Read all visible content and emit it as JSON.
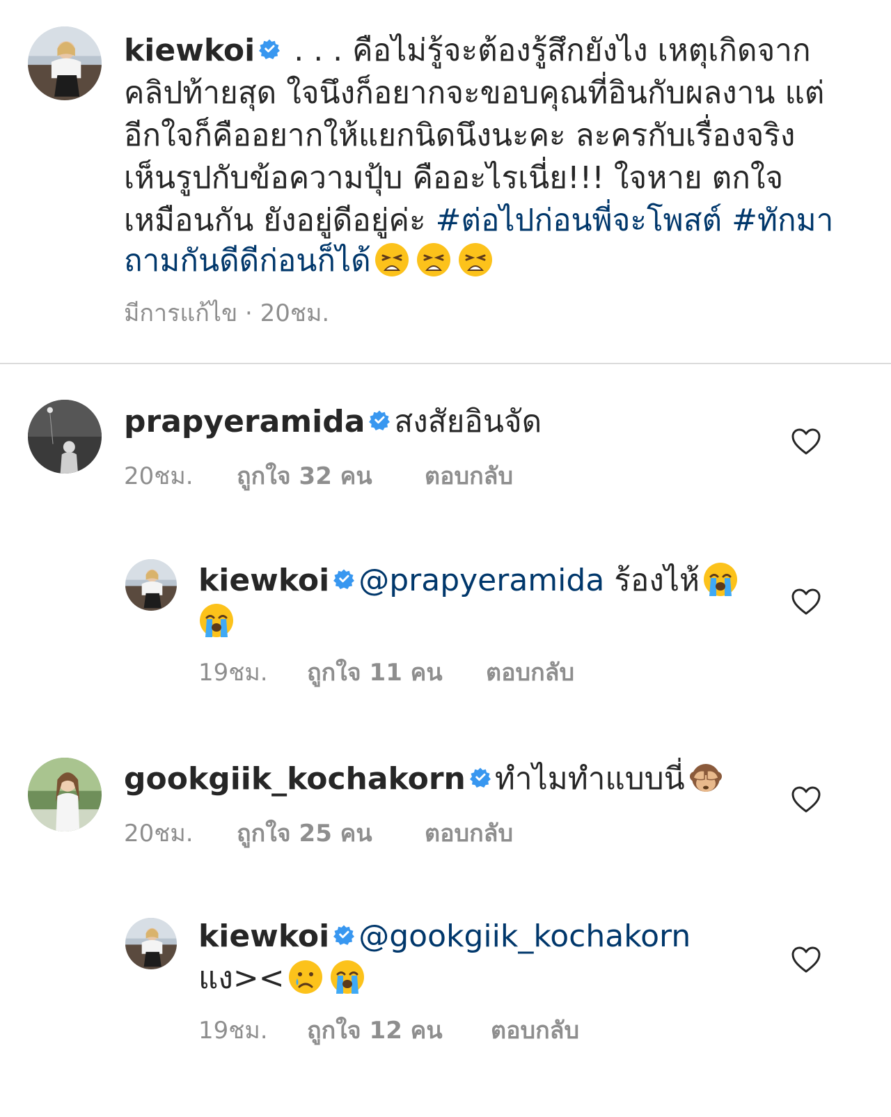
{
  "caption": {
    "username": "kiewkoi",
    "lines": [
      " . . . คือไม่รู้จะต้องรู้สึกยังไง เหตุเกิดจาก",
      "คลิปท้ายสุด ใจนึงก็อยากจะขอบคุณที่อินกับผลงาน แต่",
      "อีกใจก็คืออยากให้แยกนิดนึงนะคะ ละครกับเรื่องจริง",
      "เห็นรูปกับข้อความปุ้บ คืออะไรเนี่ย!!! ใจหาย ตกใจ",
      "เหมือนกัน ยังอยู่ดีอยู่ค่ะ "
    ],
    "hashtag_1": "#ต่อไปก่อนพี่จะโพสต์",
    "hashtag_2": "#ทักมา",
    "hashtag_2_cont": "ถามกันดีดีก่อนก็ได้",
    "emoji": "weary-face-emoji",
    "edited_label": "มีการแก้ไข · 20ชม."
  },
  "comments": [
    {
      "username": "prapyeramida",
      "text": "สงสัยอินจัด",
      "time": "20ชม.",
      "likes": "ถูกใจ 32 คน",
      "reply": "ตอบกลับ"
    },
    {
      "username": "kiewkoi",
      "mention": "@prapyeramida",
      "text": " ร้องไห้",
      "emoji": "loudly-crying-face-emoji",
      "time": "19ชม.",
      "likes": "ถูกใจ 11 คน",
      "reply": "ตอบกลับ"
    },
    {
      "username": "gookgiik_kochakorn",
      "text": "ทำไมทำแบบนี่",
      "emoji": "see-no-evil-monkey-emoji",
      "time": "20ชม.",
      "likes": "ถูกใจ 25 คน",
      "reply": "ตอบกลับ"
    },
    {
      "username": "kiewkoi",
      "mention": "@gookgiik_kochakorn",
      "text": "แง><",
      "emoji": "crying-face-emoji",
      "emoji_2": "loudly-crying-face-emoji",
      "time": "19ชม.",
      "likes": "ถูกใจ 12 คน",
      "reply": "ตอบกลับ"
    }
  ],
  "colors": {
    "text": "#262626",
    "link": "#00376b",
    "secondary": "#8e8e8e",
    "verified": "#3897f0",
    "divider": "#dbdbdb"
  }
}
